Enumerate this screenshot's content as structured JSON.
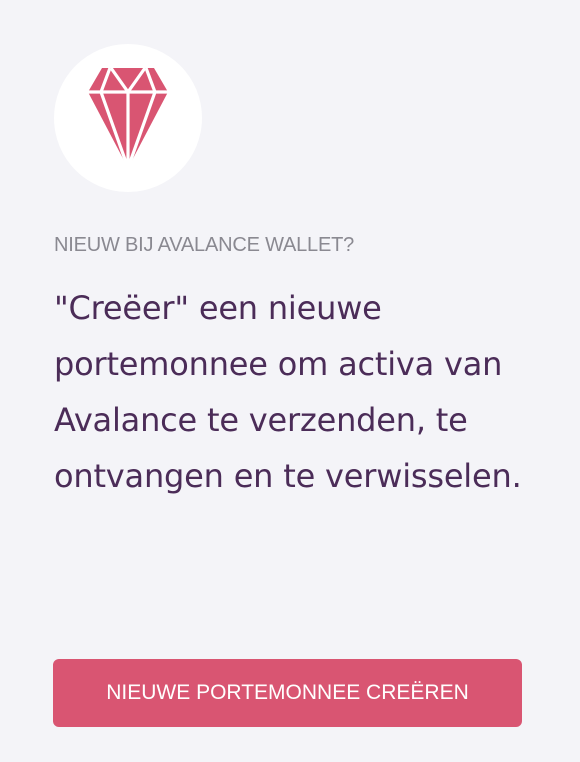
{
  "icon": {
    "name": "diamond-icon",
    "color": "#d95572"
  },
  "intro": {
    "eyebrow": "NIEUW BIJ AVALANCE WALLET?",
    "description": "\"Creëer\" een nieuwe portemonnee om activa van Avalance te verzenden, te ontvangen en te verwisselen."
  },
  "actions": {
    "create_label": "NIEUWE PORTEMONNEE CREËREN"
  },
  "colors": {
    "background": "#f4f4f8",
    "accent": "#d95572",
    "heading": "#4b2c58",
    "muted": "#8a8991"
  }
}
